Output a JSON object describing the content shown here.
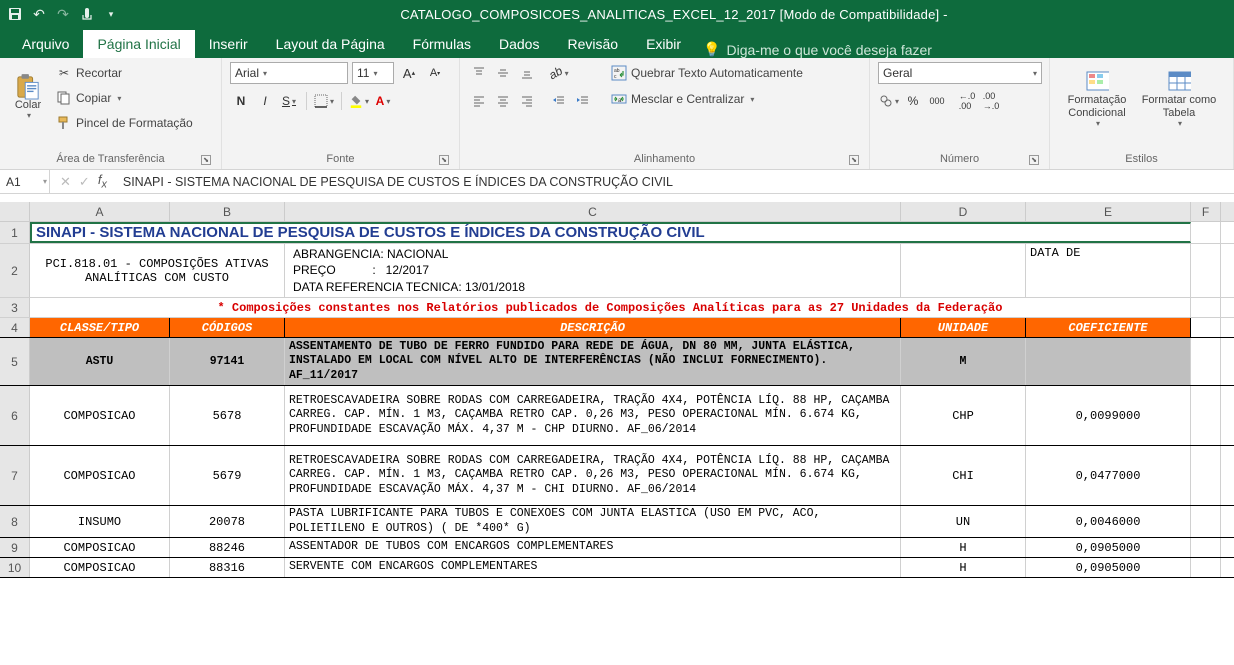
{
  "window": {
    "title": "CATALOGO_COMPOSICOES_ANALITICAS_EXCEL_12_2017  [Modo de Compatibilidade]  -"
  },
  "tabs": {
    "arquivo": "Arquivo",
    "inicio": "Página Inicial",
    "inserir": "Inserir",
    "layout": "Layout da Página",
    "formulas": "Fórmulas",
    "dados": "Dados",
    "revisao": "Revisão",
    "exibir": "Exibir",
    "tellme": "Diga-me o que você deseja fazer"
  },
  "ribbon": {
    "clipboard": {
      "paste": "Colar",
      "cut": "Recortar",
      "copy": "Copiar",
      "painter": "Pincel de Formatação",
      "label": "Área de Transferência"
    },
    "font": {
      "name": "Arial",
      "size": "11",
      "bold": "N",
      "italic": "I",
      "underline": "S",
      "label": "Fonte"
    },
    "alignment": {
      "wrap": "Quebrar Texto Automaticamente",
      "merge": "Mesclar e Centralizar",
      "label": "Alinhamento"
    },
    "number": {
      "format": "Geral",
      "label": "Número"
    },
    "styles": {
      "cond": "Formatação Condicional",
      "table": "Formatar como Tabela",
      "label": "Estilos"
    }
  },
  "namebox": "A1",
  "formula": "SINAPI - SISTEMA NACIONAL DE PESQUISA DE CUSTOS E ÍNDICES DA CONSTRUÇÃO CIVIL",
  "cols": {
    "A": "A",
    "B": "B",
    "C": "C",
    "D": "D",
    "E": "E",
    "F": "F"
  },
  "rows": [
    "1",
    "2",
    "3",
    "4",
    "5",
    "6",
    "7",
    "8",
    "9",
    "10"
  ],
  "sheet": {
    "title": "SINAPI - SISTEMA NACIONAL DE PESQUISA DE CUSTOS E ÍNDICES DA CONSTRUÇÃO CIVIL",
    "sub_left": "PCI.818.01 - COMPOSIÇÕES ATIVAS ANALÍTICAS COM CUSTO",
    "abrang": "ABRANGENCIA: NACIONAL",
    "preco": "PREÇO           :   12/2017",
    "data_ref": "DATA REFERENCIA TECNICA: 13/01/2018",
    "data_de": "DATA DE",
    "note": "* Composições constantes nos Relatórios publicados de Composições Analíticas para as 27 Unidades da Federação",
    "headers": {
      "classe": "CLASSE/TIPO",
      "cod": "CÓDIGOS",
      "desc": "DESCRIÇÃO",
      "unid": "UNIDADE",
      "coef": "COEFICIENTE"
    },
    "r5": {
      "classe": "ASTU",
      "cod": "97141",
      "desc": "ASSENTAMENTO DE TUBO DE FERRO FUNDIDO PARA REDE DE ÁGUA, DN 80 MM, JUNTA ELÁSTICA, INSTALADO EM LOCAL COM NÍVEL ALTO DE INTERFERÊNCIAS (NÃO INCLUI FORNECIMENTO). AF_11/2017",
      "unid": "M",
      "coef": ""
    },
    "r6": {
      "classe": "COMPOSICAO",
      "cod": "5678",
      "desc": "RETROESCAVADEIRA SOBRE RODAS COM CARREGADEIRA, TRAÇÃO 4X4, POTÊNCIA LÍQ. 88 HP, CAÇAMBA CARREG. CAP. MÍN. 1 M3, CAÇAMBA RETRO CAP. 0,26 M3, PESO OPERACIONAL MÍN. 6.674 KG, PROFUNDIDADE ESCAVAÇÃO MÁX. 4,37 M - CHP DIURNO. AF_06/2014",
      "unid": "CHP",
      "coef": "0,0099000"
    },
    "r7": {
      "classe": "COMPOSICAO",
      "cod": "5679",
      "desc": "RETROESCAVADEIRA SOBRE RODAS COM CARREGADEIRA, TRAÇÃO 4X4, POTÊNCIA LÍQ. 88 HP, CAÇAMBA CARREG. CAP. MÍN. 1 M3, CAÇAMBA RETRO CAP. 0,26 M3, PESO OPERACIONAL MÍN. 6.674 KG, PROFUNDIDADE ESCAVAÇÃO MÁX. 4,37 M - CHI DIURNO. AF_06/2014",
      "unid": "CHI",
      "coef": "0,0477000"
    },
    "r8": {
      "classe": "INSUMO",
      "cod": "20078",
      "desc": "PASTA LUBRIFICANTE PARA TUBOS E CONEXOES COM JUNTA ELASTICA (USO EM PVC, ACO, POLIETILENO E OUTROS) ( DE *400* G)",
      "unid": "UN",
      "coef": "0,0046000"
    },
    "r9": {
      "classe": "COMPOSICAO",
      "cod": "88246",
      "desc": "ASSENTADOR DE TUBOS COM ENCARGOS COMPLEMENTARES",
      "unid": "H",
      "coef": "0,0905000"
    },
    "r10": {
      "classe": "COMPOSICAO",
      "cod": "88316",
      "desc": "SERVENTE COM ENCARGOS COMPLEMENTARES",
      "unid": "H",
      "coef": "0,0905000"
    }
  }
}
